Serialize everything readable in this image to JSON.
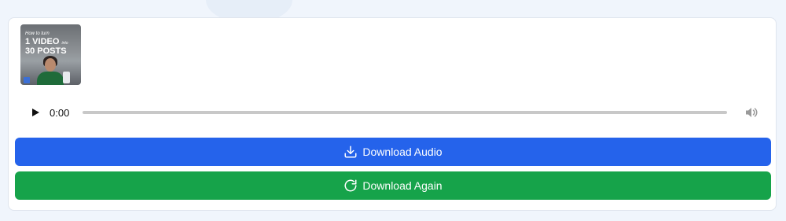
{
  "player": {
    "thumbnail": {
      "line1": "How to turn",
      "line2": "1 VIDEO",
      "line2_small": "into",
      "line3": "30 POSTS"
    },
    "current_time": "0:00",
    "progress": 0,
    "icons": {
      "play": "play-icon",
      "volume": "volume-icon"
    }
  },
  "buttons": {
    "download_audio": {
      "label": "Download Audio",
      "icon": "download-icon",
      "color": "#2563eb"
    },
    "download_again": {
      "label": "Download Again",
      "icon": "refresh-icon",
      "color": "#16a34a"
    }
  }
}
